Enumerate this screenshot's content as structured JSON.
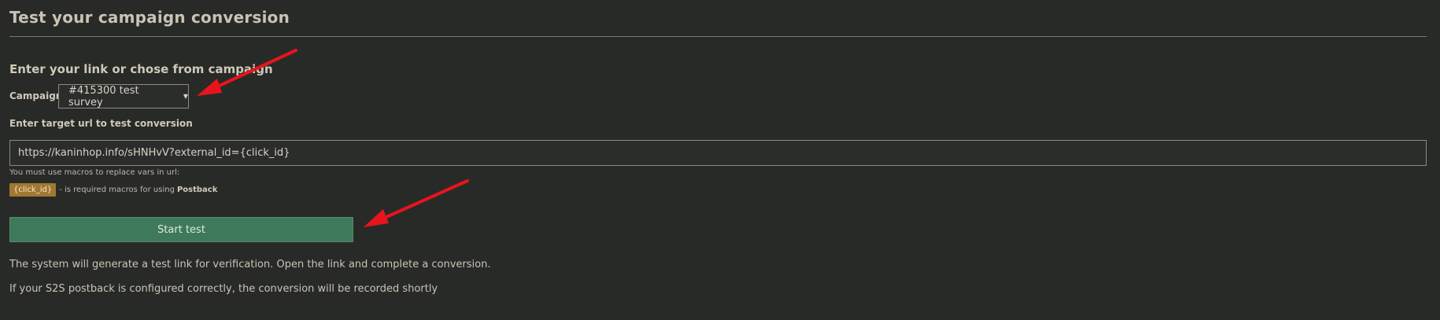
{
  "header": {
    "title": "Test your campaign conversion"
  },
  "form": {
    "section_heading": "Enter your link or chose from campaign",
    "campaign_label": "Campaign:",
    "campaign_selected": "#415300 test survey",
    "target_label": "Enter target url to test conversion",
    "target_url": "https://kaninhop.info/sHNHvV?external_id={click_id}",
    "macro_hint": "You must use macros to replace vars in url:",
    "macro_badge": "{click_id}",
    "macro_text": "- is required macros for using",
    "macro_strong": "Postback",
    "start_button": "Start test"
  },
  "info": {
    "line1": "The system will generate a test link for verification. Open the link and complete a conversion.",
    "line2": "If your S2S postback is configured correctly, the conversion will be recorded shortly"
  },
  "icons": {
    "caret": "▼"
  },
  "colors": {
    "background": "#282a28",
    "button": "#3e7a5a",
    "badge": "#a07830",
    "annotation_arrow": "#e8141c"
  }
}
